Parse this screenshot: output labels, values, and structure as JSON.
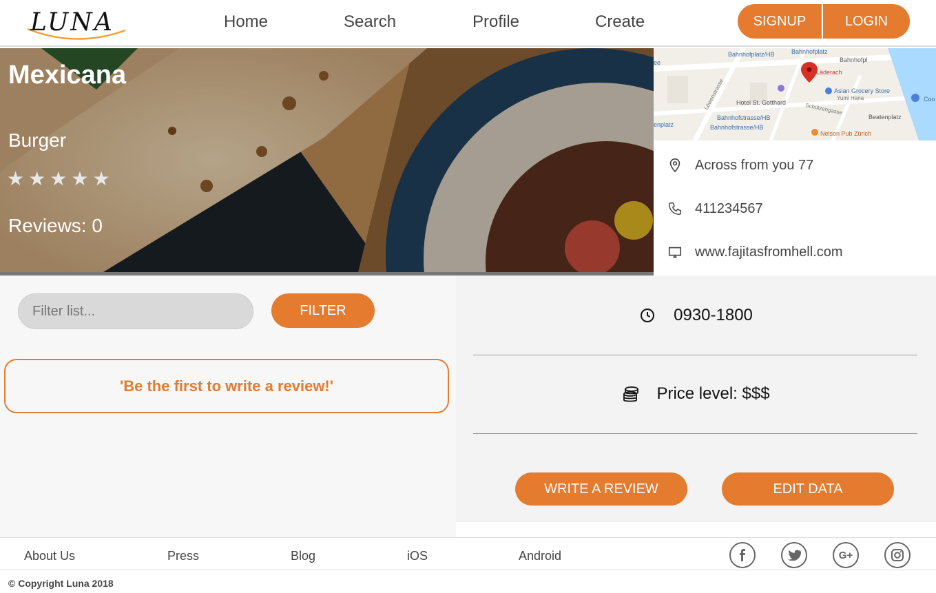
{
  "header": {
    "logo_text": "LUNA",
    "nav": [
      "Home",
      "Search",
      "Profile",
      "Create"
    ],
    "signup_label": "SIGNUP",
    "login_label": "LOGIN"
  },
  "restaurant": {
    "name": "Mexicana",
    "category": "Burger",
    "rating": 0,
    "max_rating": 5,
    "reviews_label": "Reviews: 0",
    "address": "Across from you 77",
    "phone": "411234567",
    "website": "www.fajitasfromhell.com",
    "hours": "0930-1800",
    "price_label": "Price level: $$$"
  },
  "map_labels": [
    "Bahnhofplatz/HB",
    "Bahnhofplatz",
    "Bahnhofpl",
    "Läderach",
    "Asian Grocery Store",
    "Yumi Hana",
    "Hotel St. Gotthard",
    "Bahnhofstrasse/HB",
    "Bahnhofstrasse/HB",
    "Beatenplatz",
    "Nelson Pub Zürich",
    "Löwenstrasse",
    "Schützengasse",
    "enplatz",
    "Coo",
    "ee"
  ],
  "filter": {
    "placeholder": "Filter list...",
    "button_label": "FILTER"
  },
  "empty_reviews_message": "'Be the first to write a review!'",
  "actions": {
    "write_review_label": "WRITE A REVIEW",
    "edit_data_label": "EDIT DATA"
  },
  "footer": {
    "links": [
      "About Us",
      "Press",
      "Blog",
      "iOS",
      "Android"
    ],
    "social": [
      "facebook-icon",
      "twitter-icon",
      "google-plus-icon",
      "instagram-icon"
    ],
    "copyright": "© Copyright Luna 2018"
  },
  "colors": {
    "accent": "#e47b2f",
    "map_pin": "#d93025"
  }
}
